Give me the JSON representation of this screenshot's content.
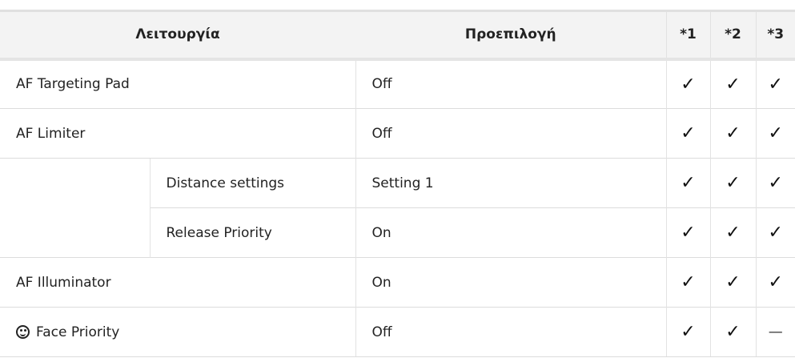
{
  "header": {
    "function": "Λειτουργία",
    "default": "Προεπιλογή",
    "c1": "*1",
    "c2": "*2",
    "c3": "*3"
  },
  "rows": [
    {
      "label": "AF Targeting Pad",
      "default": "Off",
      "c1": "✓",
      "c2": "✓",
      "c3": "✓"
    },
    {
      "label": "AF Limiter",
      "default": "Off",
      "c1": "✓",
      "c2": "✓",
      "c3": "✓"
    },
    {
      "label": "Distance settings",
      "default": "Setting 1",
      "c1": "✓",
      "c2": "✓",
      "c3": "✓"
    },
    {
      "label": "Release Priority",
      "default": "On",
      "c1": "✓",
      "c2": "✓",
      "c3": "✓"
    },
    {
      "label": "AF Illuminator",
      "default": "On",
      "c1": "✓",
      "c2": "✓",
      "c3": "✓"
    },
    {
      "label": "Face Priority",
      "icon": "face-priority-icon",
      "default": "Off",
      "c1": "✓",
      "c2": "✓",
      "c3": "—"
    }
  ]
}
